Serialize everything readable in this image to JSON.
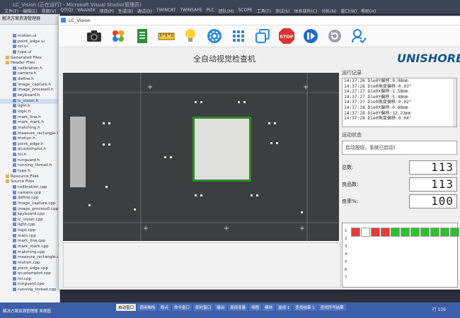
{
  "vs": {
    "title": "LC_Vision (正在运行) - Microsoft Visual Studio(管理员)",
    "menu": [
      "文件(F)",
      "编辑(E)",
      "视图(V)",
      "QT(Q)",
      "VAssistX",
      "项目(P)",
      "生成(B)",
      "调试(D)",
      "TWINCAT",
      "TWINSAFE",
      "PLC",
      "团队(M)",
      "SCOPE",
      "工具(T)",
      "测试(S)",
      "体系结构(C)",
      "分析(N)",
      "窗口(W)",
      "帮助(H)"
    ],
    "side_head": "解决方案资源管理器",
    "tree": [
      "motion.ui",
      "point_edge.ui",
      "roi.ui",
      "type.ui",
      "Generated Files",
      "Header Files",
      "calibration.h",
      "camera.h",
      "define.h",
      "image_capture.h",
      "image_process0.h",
      "keyboard.h",
      "lc_vision.h",
      "light.h",
      "logic.h",
      "mark_line.h",
      "mark_mark.h",
      "matching.h",
      "measure_rectangle.h",
      "motion.h",
      "point_edge.h",
      "qcustomplot.h",
      "roi.h",
      "runguard.h",
      "running_thread.h",
      "type.h",
      "Resource Files",
      "Source Files",
      "calibration.cpp",
      "camera.cpp",
      "define.cpp",
      "image_capture.cpp",
      "image_process0.cpp",
      "keyboard.cpp",
      "lc_vision.cpp",
      "light.cpp",
      "logic.cpp",
      "main.cpp",
      "mark_line.cpp",
      "mark_mark.cpp",
      "matching.cpp",
      "measure_rectangle.cpp",
      "motion.cpp",
      "point_edge.cpp",
      "qcustomplot.cpp",
      "roi.cpp",
      "runguard.cpp",
      "running_thread.cpp"
    ],
    "bottom_tabs": [
      "自动窗口",
      "调用堆栈",
      "断点",
      "命令窗口",
      "即时窗口",
      "输出",
      "局部变量",
      "线程",
      "模块",
      "监视 1",
      "查找结果 1",
      "查找符号结果"
    ],
    "side_bottom": "解决方案资源管理器  类视图",
    "status": "行 109"
  },
  "app": {
    "window_title": "LC_Vision",
    "heading": "全自动视觉检查机",
    "logo_text": "UNISHORE",
    "toolbar_icons": [
      "camera-icon",
      "joomla-icon",
      "exit-door-icon",
      "ruler-icon",
      "lightbulb-icon",
      "settings-gear-icon",
      "grid-icon",
      "windows-icon",
      "stop-icon",
      "pause-icon",
      "refresh-icon",
      "user-check-icon"
    ],
    "stop_label": "STOP",
    "log_label": "运行记录",
    "log_lines": [
      "14:37:26 Die0Y偏移:0.98mm",
      "14:37:26 Die0角度偏移:0.03°",
      "14:37:27 Die0X偏移:1.58mm",
      "14:37:27 Die0Y偏移:5.48mm",
      "14:37:27 Die0角度偏移:0.02°",
      "14:37:28 Die0X偏移:0.88mm",
      "14:37:28 Die0Y偏移:12.23mm",
      "14:37:28 Die0角度偏移:0.04°"
    ],
    "status_label": "运动状态",
    "status_text": "启动按钮，系统已启动!",
    "total_label": "总数:",
    "total_value": "113",
    "good_label": "良品数:",
    "good_value": "113",
    "yield_label": "良率%:",
    "yield_value": "100",
    "grid_row_labels": [
      "1",
      "2",
      "3",
      "4",
      "5",
      "6",
      "7"
    ],
    "grid_cells": [
      "ng",
      "white",
      "ng",
      "ng",
      "ok",
      "ok",
      "ok",
      "ok",
      "ok",
      "ok",
      "ok",
      "ok",
      "ok"
    ],
    "colors": {
      "ok": "#2fbf2f",
      "ng": "#e23c3c",
      "accent": "#12568f",
      "logo_arc": "#e08b25"
    }
  }
}
